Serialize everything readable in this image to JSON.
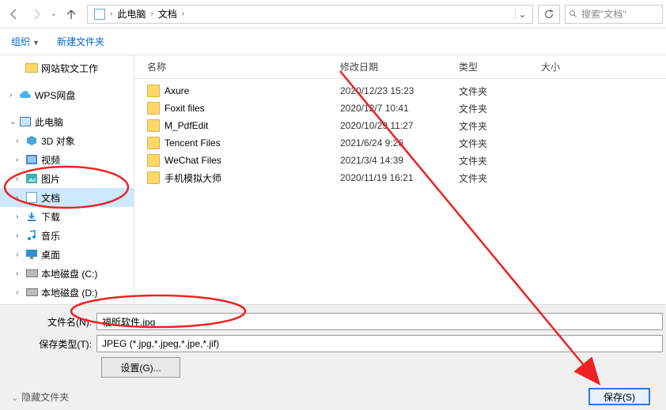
{
  "breadcrumb": {
    "pc": "此电脑",
    "docs": "文档"
  },
  "search": {
    "placeholder": "搜索\"文档\""
  },
  "toolbar": {
    "organize": "组织",
    "newfolder": "新建文件夹"
  },
  "tree": {
    "webwork": "网站软文工作",
    "wps": "WPS网盘",
    "pc": "此电脑",
    "obj3d": "3D 对象",
    "video": "视频",
    "pictures": "图片",
    "docs": "文档",
    "downloads": "下载",
    "music": "音乐",
    "desktop": "桌面",
    "diskc": "本地磁盘 (C:)",
    "diskd": "本地磁盘 (D:)"
  },
  "headers": {
    "name": "名称",
    "date": "修改日期",
    "type": "类型",
    "size": "大小"
  },
  "rows": [
    {
      "name": "Axure",
      "date": "2020/12/23 15:23",
      "type": "文件夹"
    },
    {
      "name": "Foxit files",
      "date": "2020/12/7 10:41",
      "type": "文件夹"
    },
    {
      "name": "M_PdfEdit",
      "date": "2020/10/29 11:27",
      "type": "文件夹"
    },
    {
      "name": "Tencent Files",
      "date": "2021/6/24 9:26",
      "type": "文件夹"
    },
    {
      "name": "WeChat Files",
      "date": "2021/3/4 14:39",
      "type": "文件夹"
    },
    {
      "name": "手机模拟大师",
      "date": "2020/11/19 16:21",
      "type": "文件夹"
    }
  ],
  "bottom": {
    "filename_label": "文件名(N):",
    "filename_value": "福昕软件.jpg",
    "filetype_label": "保存类型(T):",
    "filetype_value": "JPEG (*.jpg,*.jpeg,*.jpe,*.jif)",
    "settings": "设置(G)...",
    "hidefolders": "隐藏文件夹",
    "save": "保存(S)"
  }
}
